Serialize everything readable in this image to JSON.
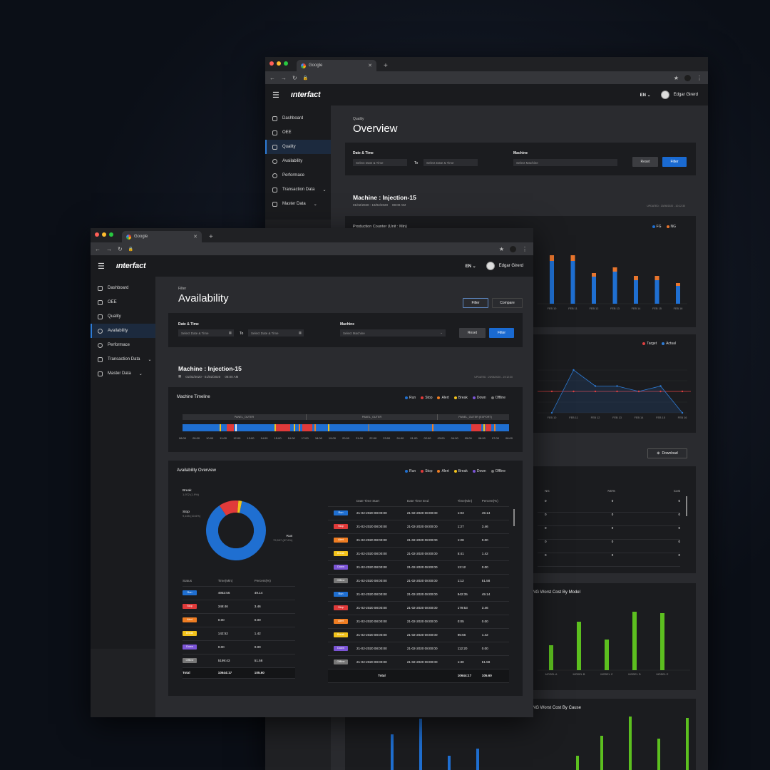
{
  "back": {
    "tab_title": "Google",
    "logo": "ınterfact",
    "lang": "EN",
    "user": "Edgar Girerd",
    "nav": [
      "Dashboard",
      "OEE",
      "Quality",
      "Availability",
      "Performace",
      "Transaction Data",
      "Master Data"
    ],
    "crumb": "Quality",
    "title": "Overview",
    "date_label": "Date & Time",
    "date_ph": "Select Date & Time",
    "to": "To",
    "machine_label": "Machine",
    "machine_ph": "Select Machine",
    "reset": "Reset",
    "filter": "Filter",
    "machine_title": "Machine : Injection-15",
    "machine_range": "01/02/2020 - 19/02/2020",
    "machine_time": "08:00 AM",
    "updated": "UPDATED : 20/05/2020 - 10:12:30",
    "prod_title": "Production Counter (Unit : Min)",
    "legend_fg": "FG",
    "legend_ng": "NG",
    "legend_target": "Target",
    "legend_actual": "Actual",
    "download": "Download",
    "ng_headers": [
      "NG",
      "NG%",
      "Cost"
    ],
    "ng_rows": [
      [
        "0",
        "0",
        "0"
      ],
      [
        "0",
        "0",
        "0"
      ],
      [
        "0",
        "0",
        "0"
      ],
      [
        "0",
        "0",
        "0"
      ],
      [
        "0",
        "0",
        "0"
      ]
    ],
    "model_title": "NG Worst Cost By Model",
    "cause_title": "NG Worst Cost By Cause"
  },
  "chart_data": [
    {
      "type": "bar",
      "title": "Production Counter (Unit : Min)",
      "categories": [
        "FEB 10",
        "FEB 11",
        "FEB 12",
        "FEB 13",
        "FEB 14",
        "FEB 15",
        "FEB 16"
      ],
      "series": [
        {
          "name": "FG",
          "values": [
            60,
            60,
            38,
            45,
            33,
            33,
            25
          ]
        },
        {
          "name": "NG",
          "values": [
            8,
            8,
            5,
            6,
            6,
            6,
            4
          ]
        }
      ],
      "colors": {
        "FG": "#1f6fd1",
        "NG": "#e8752d"
      }
    },
    {
      "type": "line",
      "categories": [
        "FEB 10",
        "FEB 11",
        "FEB 12",
        "FEB 13",
        "FEB 14",
        "FEB 15",
        "FEB 16"
      ],
      "series": [
        {
          "name": "Target",
          "values": [
            2,
            2,
            2,
            2,
            2,
            2,
            2
          ]
        },
        {
          "name": "Actual",
          "values": [
            0,
            4,
            2.5,
            2.5,
            2,
            2.5,
            0
          ]
        }
      ],
      "colors": {
        "Target": "#e04040",
        "Actual": "#2e7cd6"
      }
    },
    {
      "type": "bar",
      "title": "NG Worst Cost By Model",
      "categories": [
        "MODEL A",
        "MODEL B",
        "MODEL C",
        "MODEL D",
        "MODEL E"
      ],
      "values": [
        35,
        68,
        43,
        82,
        80
      ],
      "color": "#5cbf1f"
    }
  ],
  "front": {
    "tab_title": "Google",
    "logo": "ınterfact",
    "lang": "EN",
    "user": "Edgar Girerd",
    "nav": [
      "Dashboard",
      "OEE",
      "Quality",
      "Availability",
      "Performace",
      "Transaction Data",
      "Master Data"
    ],
    "crumb": "Filter",
    "title": "Availability",
    "filter_btn": "Filter",
    "compare_btn": "Compare",
    "date_label": "Date & Time",
    "date_ph": "Select Date & Time",
    "to": "To",
    "machine_label": "Machine",
    "machine_ph": "Select Machine",
    "reset": "Reset",
    "filter": "Filter",
    "machine_title": "Machine : Injection-15",
    "machine_range": "01/02/2020 - 01/02/2020",
    "machine_time": "08:00 AM",
    "updated": "UPDATED : 20/05/2020 - 19:12:30",
    "timeline_title": "Machine Timeline",
    "status_legend": [
      {
        "name": "Run",
        "color": "#1f6fd1"
      },
      {
        "name": "Stop",
        "color": "#e03a3a"
      },
      {
        "name": "Alert",
        "color": "#ef7d22"
      },
      {
        "name": "Break",
        "color": "#f2c21b"
      },
      {
        "name": "Down",
        "color": "#7b54d6"
      },
      {
        "name": "Offline",
        "color": "#777777"
      }
    ],
    "panels": [
      "PANEL_OUTER",
      "PANEL_OUTER",
      "PANEL_OUTER (EXPORT)"
    ],
    "hours": [
      "08:00",
      "09:00",
      "10:00",
      "11:00",
      "12:00",
      "13:00",
      "14:00",
      "15:00",
      "16:00",
      "17:00",
      "18:00",
      "19:00",
      "20:00",
      "21:00",
      "22:00",
      "23:00",
      "24:00",
      "01:00",
      "02:00",
      "03:00",
      "04:00",
      "05:00",
      "06:00",
      "07:00",
      "08:00"
    ],
    "overview_title": "Availability Overview",
    "donut_labels": {
      "break": "Break",
      "break_val": "1,972 (1.9%)",
      "stop": "Stop",
      "stop_val": "9,155 (10.6%)",
      "run": "Run",
      "run_val": "79,597 (87.6%)"
    },
    "sum_headers": [
      "Status",
      "Time(Min)",
      "Percent(%)"
    ],
    "sum_rows": [
      [
        "Run",
        "4952:56",
        "49.14"
      ],
      [
        "Stop",
        "348:46",
        "3.46"
      ],
      [
        "Alert",
        "0.00",
        "0.00"
      ],
      [
        "Break",
        "142:52",
        "1.42"
      ],
      [
        "Down",
        "0.00",
        "0.00"
      ],
      [
        "Offline",
        "5199:43",
        "51.58"
      ]
    ],
    "sum_total": [
      "Total",
      "10644:17",
      "105.60"
    ],
    "det_headers": [
      "",
      "Date Time Start",
      "Date Time End",
      "Time(Min)",
      "Percent(%)"
    ],
    "det_rows": [
      [
        "Run",
        "21-02-2020 08:00:00",
        "21-02-2020 08:00:00",
        "1:03",
        "49.14"
      ],
      [
        "Stop",
        "21-02-2020 08:00:00",
        "21-02-2020 08:00:00",
        "1:27",
        "3.46"
      ],
      [
        "Alert",
        "21-02-2020 08:00:00",
        "21-02-2020 08:00:00",
        "1:28",
        "0.00"
      ],
      [
        "Break",
        "21-02-2020 08:00:00",
        "21-02-2020 08:00:00",
        "5:41",
        "1.42"
      ],
      [
        "Down",
        "21-02-2020 08:00:00",
        "21-02-2020 08:00:00",
        "13:12",
        "0.00"
      ],
      [
        "Offline",
        "21-02-2020 08:00:00",
        "21-02-2020 08:00:00",
        "1:12",
        "51.58"
      ],
      [
        "Run",
        "21-02-2020 08:00:00",
        "21-02-2020 08:00:00",
        "942:35",
        "49.14"
      ],
      [
        "Stop",
        "21-02-2020 08:00:00",
        "21-02-2020 08:00:00",
        "179:53",
        "3.46"
      ],
      [
        "Alert",
        "21-02-2020 08:00:00",
        "21-02-2020 08:00:00",
        "0:05",
        "0.00"
      ],
      [
        "Break",
        "21-02-2020 08:00:00",
        "21-02-2020 08:00:00",
        "95:56",
        "1.42"
      ],
      [
        "Down",
        "21-02-2020 08:00:00",
        "21-02-2020 08:00:00",
        "112:20",
        "0.00"
      ],
      [
        "Offline",
        "21-02-2020 08:00:00",
        "21-02-2020 08:00:00",
        "1:30",
        "51.58"
      ]
    ],
    "det_total": [
      "Total",
      "10644:17",
      "105.60"
    ]
  },
  "availability_donut": {
    "type": "pie",
    "series": [
      {
        "name": "Run",
        "value": 87.6,
        "color": "#1f6fd1"
      },
      {
        "name": "Stop",
        "value": 10.6,
        "color": "#e03a3a"
      },
      {
        "name": "Break",
        "value": 1.9,
        "color": "#f2c21b"
      }
    ]
  }
}
